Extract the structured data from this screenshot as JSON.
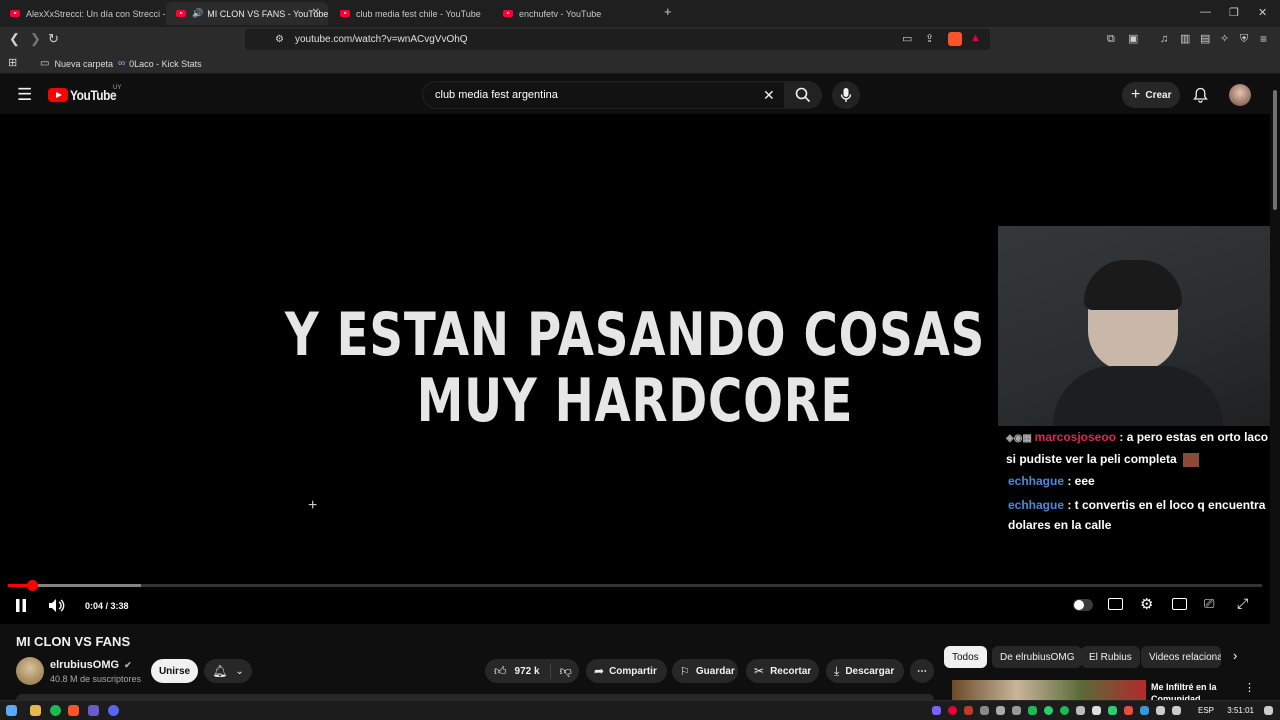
{
  "browser": {
    "tabs": [
      {
        "title": "AlexXxStrecci: Un día con Strecci - Yo"
      },
      {
        "title": "MI CLON VS FANS - YouTube"
      },
      {
        "title": "club media fest chile - YouTube"
      },
      {
        "title": "enchufetv - YouTube"
      }
    ],
    "url": "youtube.com/watch?v=wnACvgVvOhQ",
    "bookmarks": [
      "Nueva carpeta",
      "0Laco - Kick Stats"
    ]
  },
  "youtube": {
    "logo_text": "YouTube",
    "region": "UY",
    "search_value": "club media fest argentina",
    "create_label": "Crear"
  },
  "video": {
    "overlay_line1": "Y ESTAN PASANDO COSAS",
    "overlay_line2": "MUY HARDCORE",
    "time": "0:04 / 3:38",
    "progress": 0.019,
    "buffered": 0.106,
    "chat": [
      {
        "user": "marcosjoseoo",
        "user_color": "#e0245e",
        "message": " : a pero estas en orto laco si pudiste ver la peli completa"
      },
      {
        "user": "echhague",
        "user_color": "#4a8ad8",
        "message": " : eee"
      },
      {
        "user": "echhague",
        "user_color": "#4a8ad8",
        "message": " : t convertis en el loco q encuentra dolares en la calle"
      }
    ]
  },
  "meta": {
    "title": "MI CLON VS FANS",
    "channel": "elrubiusOMG",
    "subscribers": "40.8 M de suscriptores",
    "join_label": "Unirse",
    "likes": "972 k",
    "share_label": "Compartir",
    "save_label": "Guardar",
    "clip_label": "Recortar",
    "download_label": "Descargar"
  },
  "chips": [
    "Todos",
    "De elrubiusOMG",
    "El Rubius",
    "Videos relacionados"
  ],
  "recommendation": {
    "title": "Me Infiltré en la Comunidad Therian"
  },
  "taskbar": {
    "lang": "ESP",
    "clock": "3:51:01"
  },
  "colors": {
    "accent": "#ff0000",
    "bg": "#0f0f0f"
  }
}
